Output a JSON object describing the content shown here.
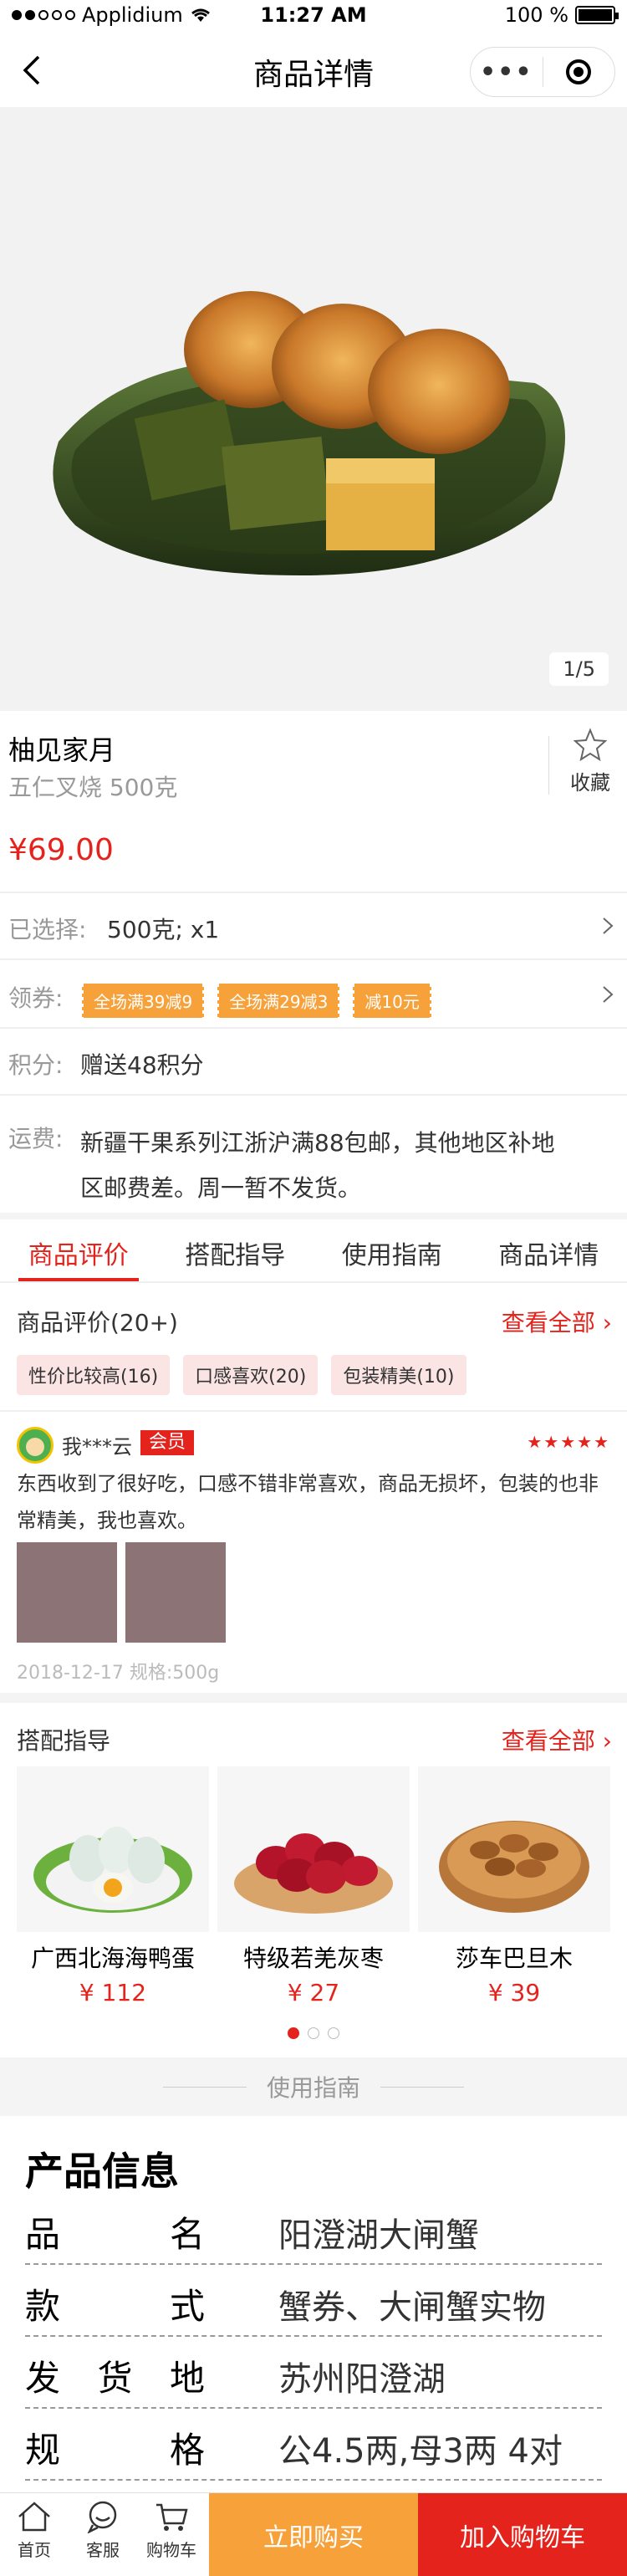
{
  "status_bar": {
    "carrier": "Applidium",
    "time": "11:27 AM",
    "battery": "100 %"
  },
  "nav": {
    "title": "商品详情",
    "more_glyph": "•••"
  },
  "gallery": {
    "pager": "1/5"
  },
  "product": {
    "name": "柚见家月",
    "spec": "五仁叉烧 500克",
    "price": "¥69.00",
    "fav_label": "收藏"
  },
  "selected": {
    "label": "已选择:",
    "value": "500克; x1"
  },
  "coupons": {
    "label": "领券:",
    "items": [
      "全场满39减9",
      "全场满29减3",
      "减10元"
    ]
  },
  "points": {
    "label": "积分:",
    "value": "赠送48积分"
  },
  "shipping": {
    "label": "运费:",
    "line1": "新疆干果系列江浙沪满88包邮，其他地区补地",
    "line2": "区邮费差。周一暂不发货。"
  },
  "tabs": [
    "商品评价",
    "搭配指导",
    "使用指南",
    "商品详情"
  ],
  "reviews": {
    "title": "商品评价(20+)",
    "see_all": "查看全部 ›",
    "tags": [
      "性价比较高(16)",
      "口感喜欢(20)",
      "包装精美(10)"
    ],
    "user": "我***云",
    "badge": "会员",
    "stars": "★★★★★",
    "text": "东西收到了很好吃，口感不错非常喜欢，商品无损坏，包装的也非常精美，我也喜欢。",
    "meta": "2018-12-17  规格:500g"
  },
  "combo": {
    "title": "搭配指导",
    "see_all": "查看全部 ›",
    "items": [
      {
        "name": "广西北海海鸭蛋",
        "price": "¥ 112"
      },
      {
        "name": "特级若羌灰枣",
        "price": "¥ 27"
      },
      {
        "name": "莎车巴旦木",
        "price": "¥ 39"
      }
    ]
  },
  "guide": {
    "heading": "使用指南"
  },
  "product_info": {
    "title": "产品信息",
    "rows": [
      {
        "key": [
          "品",
          "名"
        ],
        "value": "阳澄湖大闸蟹"
      },
      {
        "key": [
          "款",
          "式"
        ],
        "value": "蟹券、大闸蟹实物"
      },
      {
        "key": [
          "发",
          "货",
          "地"
        ],
        "value": "苏州阳澄湖"
      },
      {
        "key": [
          "规",
          "格"
        ],
        "value": "公4.5两,母3两 4对"
      }
    ]
  },
  "bottom": {
    "home": "首页",
    "service": "客服",
    "cart": "购物车",
    "buy_now": "立即购买",
    "add_cart": "加入购物车"
  },
  "colors": {
    "accent": "#e4231c",
    "orange": "#f7a13a"
  }
}
